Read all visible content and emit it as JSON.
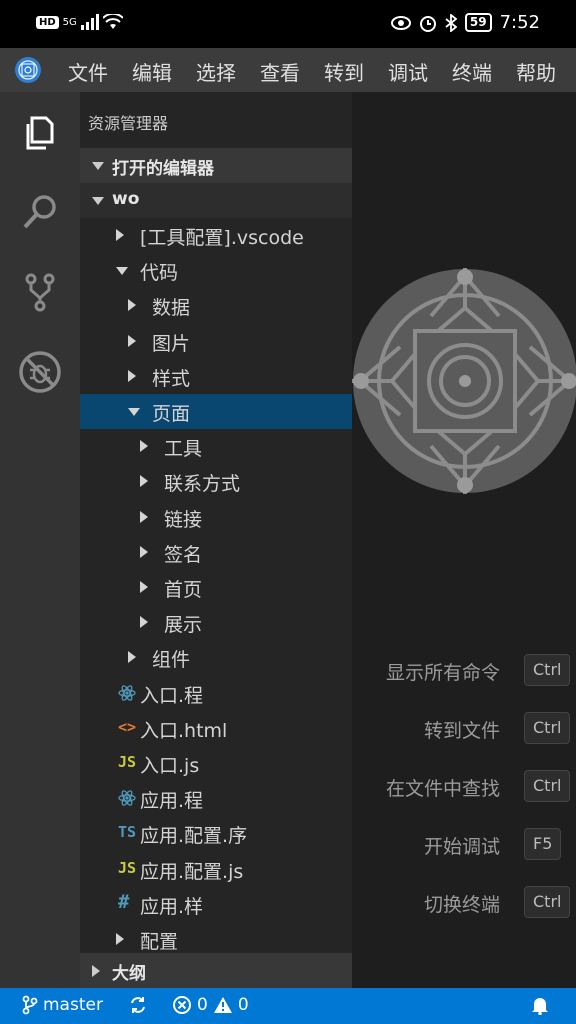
{
  "status_bar": {
    "network": "HD",
    "signal": "5G",
    "battery": "59",
    "time": "7:52"
  },
  "menu": {
    "items": [
      "文件",
      "编辑",
      "选择",
      "查看",
      "转到",
      "调试",
      "终端",
      "帮助"
    ]
  },
  "activity": {
    "icons": [
      "files-icon",
      "search-icon",
      "source-control-icon",
      "debug-icon"
    ]
  },
  "explorer": {
    "title": "资源管理器",
    "open_editors": "打开的编辑器",
    "workspace": "wo",
    "outline": "大纲",
    "tree": [
      {
        "label": "[工具配置].vscode",
        "type": "folder",
        "expanded": false
      },
      {
        "label": "代码",
        "type": "folder",
        "expanded": true
      },
      {
        "label": "数据",
        "type": "folder",
        "expanded": false
      },
      {
        "label": "图片",
        "type": "folder",
        "expanded": false
      },
      {
        "label": "样式",
        "type": "folder",
        "expanded": false
      },
      {
        "label": "页面",
        "type": "folder",
        "expanded": true,
        "selected": true
      },
      {
        "label": "工具",
        "type": "folder",
        "expanded": false
      },
      {
        "label": "联系方式",
        "type": "folder",
        "expanded": false
      },
      {
        "label": "链接",
        "type": "folder",
        "expanded": false
      },
      {
        "label": "签名",
        "type": "folder",
        "expanded": false
      },
      {
        "label": "首页",
        "type": "folder",
        "expanded": false
      },
      {
        "label": "展示",
        "type": "folder",
        "expanded": false
      },
      {
        "label": "组件",
        "type": "folder",
        "expanded": false
      },
      {
        "label": "入口.程",
        "type": "react"
      },
      {
        "label": "入口.html",
        "type": "html"
      },
      {
        "label": "入口.js",
        "type": "js"
      },
      {
        "label": "应用.程",
        "type": "react"
      },
      {
        "label": "应用.配置.序",
        "type": "ts"
      },
      {
        "label": "应用.配置.js",
        "type": "js"
      },
      {
        "label": "应用.样",
        "type": "css"
      },
      {
        "label": "配置",
        "type": "folder",
        "expanded": false
      }
    ],
    "file_icon_text": {
      "js": "JS",
      "ts": "TS",
      "css": "#",
      "html": "<>"
    }
  },
  "shortcuts": [
    {
      "label": "显示所有命令",
      "key": "Ctrl"
    },
    {
      "label": "转到文件",
      "key": "Ctrl"
    },
    {
      "label": "在文件中查找",
      "key": "Ctrl"
    },
    {
      "label": "开始调试",
      "key": "F5"
    },
    {
      "label": "切换终端",
      "key": "Ctrl"
    }
  ],
  "bottom": {
    "branch": "master",
    "errors": "0",
    "warnings": "0"
  },
  "colors": {
    "accent": "#0078d4",
    "selection": "#094771",
    "js": "#cbcb41",
    "ts": "#519aba",
    "css": "#519aba",
    "html": "#e37933",
    "react": "#519aba"
  }
}
